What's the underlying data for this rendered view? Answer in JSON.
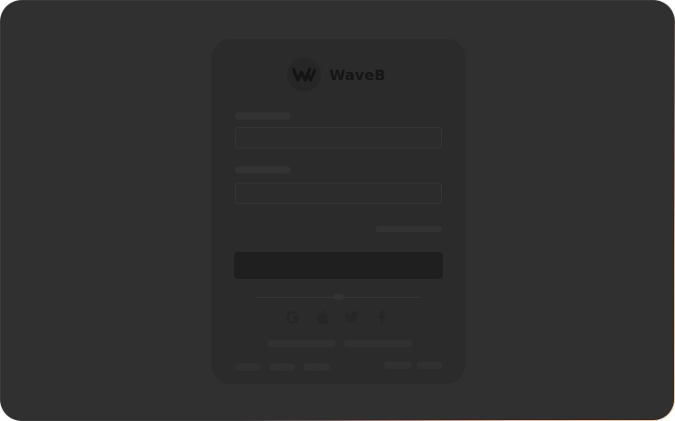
{
  "brand": {
    "name": "WaveB",
    "logo_icon": "wave-logo-icon"
  },
  "social_login": [
    {
      "icon": "google-icon"
    },
    {
      "icon": "apple-icon"
    },
    {
      "icon": "twitter-icon"
    },
    {
      "icon": "facebook-icon"
    }
  ],
  "colors": {
    "screen_background": "#303030",
    "card_background": "#2b2b2b",
    "brand_text": "#151515",
    "submit_button": "#1f1f1f",
    "frame_glow_pink": "#f2b8a6",
    "frame_glow_gold": "#f6d49a"
  }
}
